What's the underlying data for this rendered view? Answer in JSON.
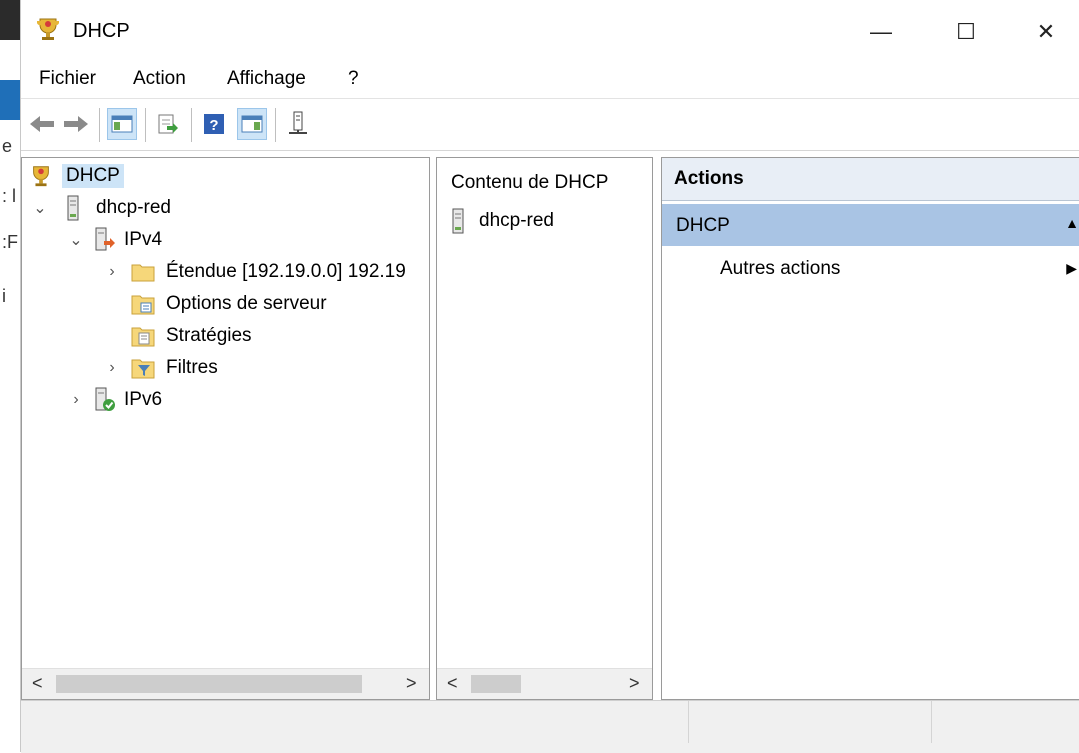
{
  "window": {
    "title": "DHCP"
  },
  "menu": [
    "Fichier",
    "Action",
    "Affichage",
    "?"
  ],
  "toolbar": {
    "buttons": [
      "back",
      "forward",
      "show-console-tree",
      "export-list",
      "help",
      "show-action-pane",
      "server-icon"
    ]
  },
  "tree": {
    "root": "DHCP",
    "server": "dhcp-red",
    "ipv4": "IPv4",
    "scope": "Étendue [192.19.0.0] 192.19",
    "server_options": "Options de serveur",
    "policies": "Stratégies",
    "filters": "Filtres",
    "ipv6": "IPv6"
  },
  "content": {
    "header": "Contenu de DHCP",
    "items": [
      "dhcp-red"
    ]
  },
  "actions": {
    "header": "Actions",
    "section": "DHCP",
    "items": [
      "Autres actions"
    ]
  },
  "colors": {
    "selection": "#cde4f7",
    "actions_section_bg": "#a9c4e4",
    "folder": "#f6d77a"
  }
}
